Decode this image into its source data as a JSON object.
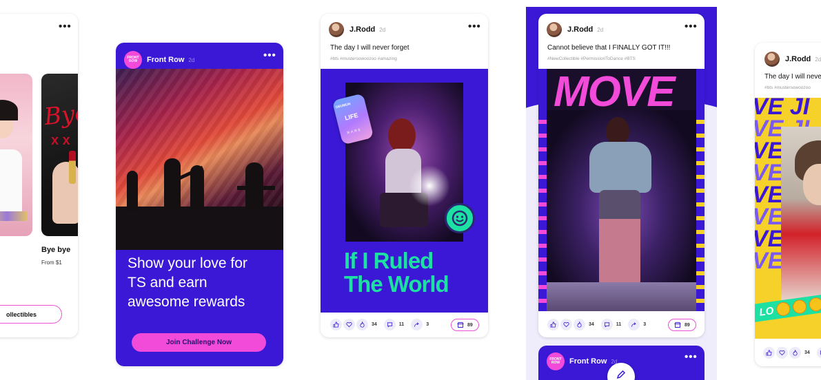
{
  "more_label": "•••",
  "card1": {
    "item_title": "Bye bye",
    "item_price": "From $1",
    "poster_text": "Bye",
    "poster_text2": "x x",
    "collectibles_button": "ollectibles"
  },
  "card2": {
    "logo_text": "FRONT ROW",
    "account": "Front Row",
    "age": "2d",
    "headline": "Show your love for TS and earn awesome rewards",
    "cta": "Join Challenge Now"
  },
  "card3": {
    "author": "J.Rodd",
    "age": "2d",
    "caption": "The day I will never forget",
    "tags": "#bts #mustersowoozoo #amazing",
    "badge_top": "DEUMUN",
    "badge_mid": "LIFE",
    "badge_bottom": "RARE",
    "poster_title_1": "If I Ruled",
    "poster_title_2": "The World",
    "likes": "34",
    "comments": "11",
    "shares": "3",
    "store_count": "89"
  },
  "card4": {
    "author": "J.Rodd",
    "age": "2d",
    "caption": "Cannot believe that I FINALLY GOT IT!!!",
    "tags": "#NewCollectible #PermissionToDance #BTS",
    "poster_title": "MOVE",
    "likes": "34",
    "comments": "11",
    "shares": "3",
    "store_count": "89",
    "next_logo_text": "FRONT ROW",
    "next_account": "Front Row",
    "next_age": "2d"
  },
  "card5": {
    "author": "J.Rodd",
    "age": "2d",
    "caption": "The day I will never",
    "tags": "#bts #mustersowoozoo",
    "pattern_text": "VE JI",
    "banner_text": "LO",
    "likes": "34"
  },
  "colors": {
    "brand_purple": "#3a18d6",
    "accent_pink": "#f24ad9",
    "accent_green": "#1de0a3"
  }
}
